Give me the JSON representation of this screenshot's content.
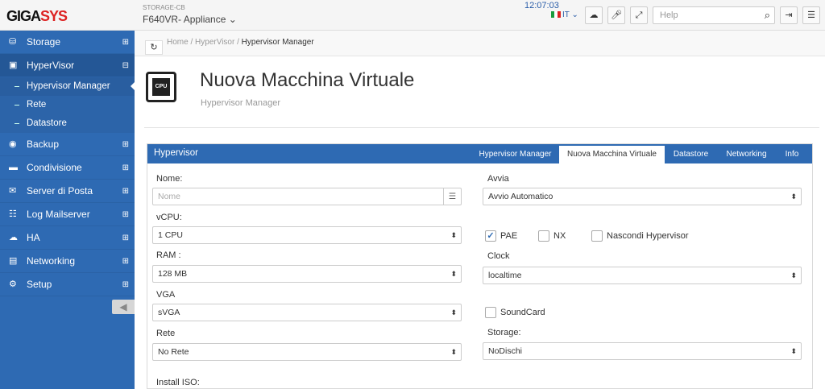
{
  "logo": {
    "text_a": "GIGA",
    "text_b": "SYS"
  },
  "device": {
    "sub": "STORAGE-CB",
    "name": "F640VR- Appliance ⌄"
  },
  "time": "12:07:03",
  "lang": "IT ⌄",
  "search": {
    "placeholder": "Help"
  },
  "sidebar": {
    "items": [
      {
        "label": "Storage",
        "icon": "database-icon"
      },
      {
        "label": "HyperVisor",
        "icon": "cpu-icon"
      },
      {
        "label": "Backup",
        "icon": "backup-icon"
      },
      {
        "label": "Condivisione",
        "icon": "folder-icon"
      },
      {
        "label": "Server di Posta",
        "icon": "mail-icon"
      },
      {
        "label": "Log Mailserver",
        "icon": "log-icon"
      },
      {
        "label": "HA",
        "icon": "cloud-icon"
      },
      {
        "label": "Networking",
        "icon": "network-icon"
      },
      {
        "label": "Setup",
        "icon": "gear-icon"
      }
    ],
    "subitems": [
      "Hypervisor Manager",
      "Rete",
      "Datastore"
    ]
  },
  "breadcrumb": {
    "home": "Home",
    "hv": "HyperVisor",
    "current": "Hypervisor Manager"
  },
  "page": {
    "title": "Nuova Macchina Virtuale",
    "subtitle": "Hypervisor Manager",
    "icon_label": "CPU"
  },
  "panel": {
    "title": "Hypervisor",
    "tabs": [
      "Hypervisor Manager",
      "Nuova Macchina Virtuale",
      "Datastore",
      "Networking",
      "Info"
    ]
  },
  "form": {
    "nome_label": "Nome:",
    "nome_ph": "Nome",
    "vcpu_label": "vCPU:",
    "vcpu_val": "1 CPU",
    "ram_label": "RAM :",
    "ram_val": "128 MB",
    "vga_label": "VGA",
    "vga_val": "sVGA",
    "rete_label": "Rete",
    "rete_val": "No Rete",
    "iso_label": "Install ISO:",
    "avvia_label": "Avvia",
    "avvia_val": "Avvio Automatico",
    "pae": "PAE",
    "nx": "NX",
    "hide": "Nascondi Hypervisor",
    "clock_label": "Clock",
    "clock_val": "localtime",
    "sound": "SoundCard",
    "storage_label": "Storage:",
    "storage_val": "NoDischi"
  }
}
